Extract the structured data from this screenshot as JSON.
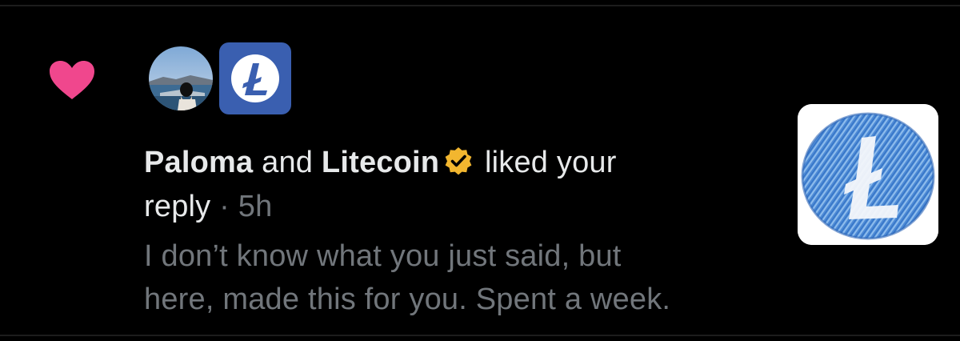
{
  "notification": {
    "action_icon": "heart-icon",
    "action_color": "#f0478d",
    "avatars": [
      {
        "name": "Paloma",
        "type": "photo"
      },
      {
        "name": "Litecoin",
        "type": "logo",
        "color": "#3a5fb0"
      }
    ],
    "actors": [
      "Paloma",
      "Litecoin"
    ],
    "connector": "and",
    "verified_badge_color": "#f2b62f",
    "action_text": "liked your",
    "action_text_2": "reply",
    "time_separator": "·",
    "time": "5h",
    "reply_line_1": "I don’t know what you just said, but",
    "reply_line_2": "here, made this for you. Spent a week.",
    "thumbnail_icon": "litecoin-drawing-icon",
    "thumbnail_color": "#3f7fcf"
  }
}
